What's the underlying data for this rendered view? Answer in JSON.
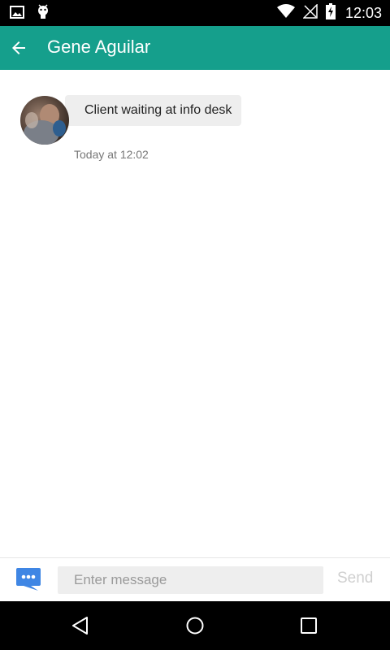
{
  "status_bar": {
    "time": "12:03",
    "icons": [
      "image-notification-icon",
      "android-notification-icon",
      "wifi-icon",
      "no-signal-icon",
      "battery-charging-icon"
    ]
  },
  "app_bar": {
    "title": "Gene Aguilar",
    "back_icon": "arrow-back-icon",
    "color": "#159f8c"
  },
  "messages": [
    {
      "sender": "Gene Aguilar",
      "text": "Client waiting at info desk",
      "timestamp": "Today at 12:02"
    }
  ],
  "compose": {
    "placeholder": "Enter message",
    "value": "",
    "send_label": "Send",
    "icon": "chat-bubble-icon",
    "icon_color": "#3f86e4"
  },
  "nav_bar": {
    "buttons": [
      "back-triangle-icon",
      "home-circle-icon",
      "recents-square-icon"
    ]
  }
}
